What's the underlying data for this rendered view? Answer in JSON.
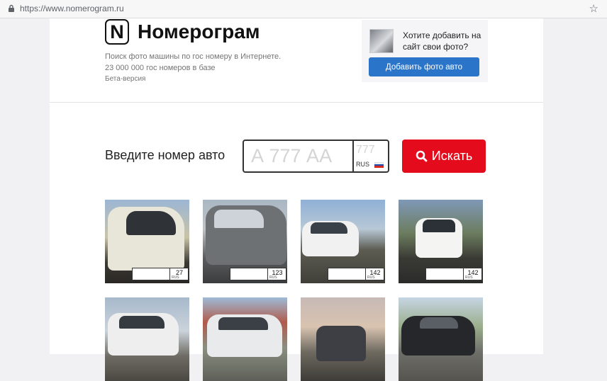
{
  "browser": {
    "url": "https://www.nomerogram.ru",
    "lock_icon": "lock-icon",
    "bookmark_icon": "star-icon"
  },
  "header": {
    "logo_letter": "N",
    "brand_name": "Номерограм",
    "tagline": "Поиск фото машины по гос номеру в Интернете.",
    "plates_count": "23 000 000 гос номеров в базе",
    "beta": "Бета-версия"
  },
  "promo": {
    "question_line1": "Хотите добавить на",
    "question_line2": "сайт свои фото?",
    "button_label": "Добавить фото авто"
  },
  "search": {
    "label": "Введите номер авто",
    "number_placeholder": "А 777 АА",
    "region_placeholder": "777",
    "country": "RUS",
    "button_label": "Искать",
    "button_icon": "search-icon"
  },
  "colors": {
    "accent_red": "#e30b1c",
    "accent_blue": "#2a74c9"
  },
  "gallery": [
    {
      "region": "27"
    },
    {
      "region": "123"
    },
    {
      "region": "142"
    },
    {
      "region": "142"
    },
    {
      "region": ""
    },
    {
      "region": ""
    },
    {
      "region": ""
    },
    {
      "region": ""
    }
  ]
}
